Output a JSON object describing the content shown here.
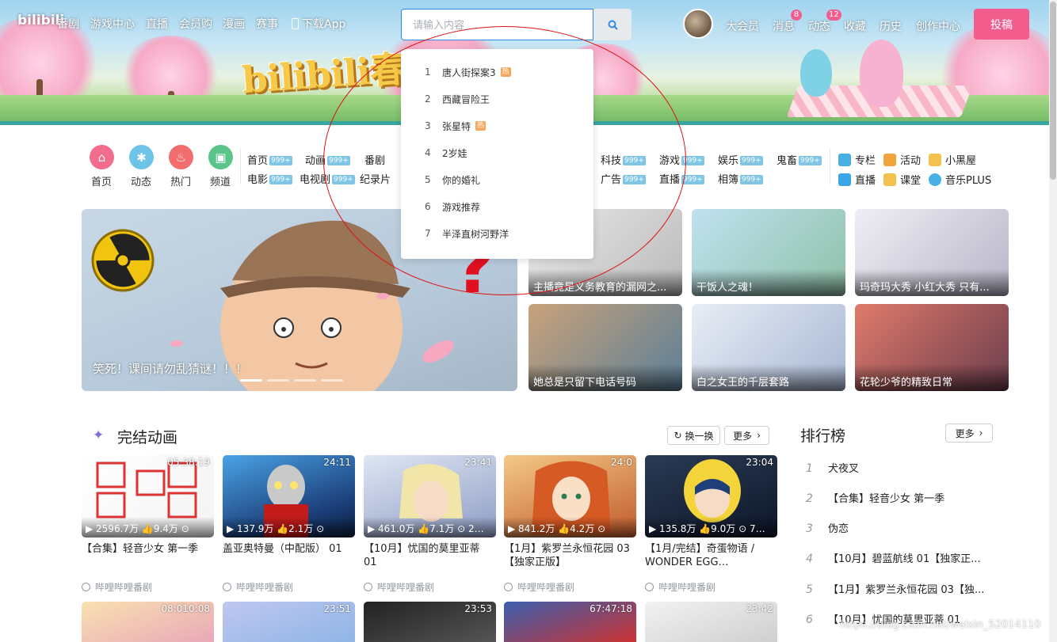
{
  "header": {
    "brand": "bilibili",
    "nav": [
      "番剧",
      "游戏中心",
      "直播",
      "会员购",
      "漫画",
      "赛事"
    ],
    "download": "下载App",
    "banner_logo": "bilibili春",
    "search": {
      "placeholder": "请输入内容",
      "icon": "search-icon"
    },
    "right": [
      "大会员",
      "消息",
      "动态",
      "收藏",
      "历史",
      "创作中心"
    ],
    "badges": {
      "messages": "8",
      "dynamics": "12"
    },
    "upload": "投稿"
  },
  "suggestions": [
    {
      "n": "1",
      "text": "唐人街探案3",
      "hot": "热"
    },
    {
      "n": "2",
      "text": "西藏冒险王",
      "hot": ""
    },
    {
      "n": "3",
      "text": "张星特",
      "hot": "热"
    },
    {
      "n": "4",
      "text": "2岁娃",
      "hot": ""
    },
    {
      "n": "5",
      "text": "你的婚礼",
      "hot": ""
    },
    {
      "n": "6",
      "text": "游戏推荐",
      "hot": ""
    },
    {
      "n": "7",
      "text": "半泽直树河野洋",
      "hot": ""
    }
  ],
  "channels": [
    {
      "label": "首页",
      "color": "#f16c8d",
      "icon": "home-icon"
    },
    {
      "label": "动态",
      "color": "#6ec4e8",
      "icon": "pinwheel-icon"
    },
    {
      "label": "热门",
      "color": "#f26d6d",
      "icon": "fire-icon"
    },
    {
      "label": "频道",
      "color": "#5bc48a",
      "icon": "channel-icon"
    }
  ],
  "categories_row1": [
    {
      "name": "首页",
      "count": "999+"
    },
    {
      "name": "动画",
      "count": "999+"
    },
    {
      "name": "番剧",
      "count": "999+"
    },
    {
      "name": "科技",
      "count": "999+"
    },
    {
      "name": "游戏",
      "count": "999+"
    },
    {
      "name": "娱乐",
      "count": "999+"
    },
    {
      "name": "鬼畜",
      "count": "999+"
    }
  ],
  "categories_row2": [
    {
      "name": "电影",
      "count": "999+"
    },
    {
      "name": "电视剧",
      "count": "999+"
    },
    {
      "name": "纪录片",
      "count": "999+"
    },
    {
      "name": "广告",
      "count": "999+"
    },
    {
      "name": "直播",
      "count": "999+"
    },
    {
      "name": "相簿",
      "count": "999+"
    }
  ],
  "extras": [
    {
      "label": "专栏",
      "color": "#48b0e3"
    },
    {
      "label": "活动",
      "color": "#f2a33a"
    },
    {
      "label": "小黑屋",
      "color": "#f2c14e"
    },
    {
      "label": "直播",
      "color": "#3aa6e8"
    },
    {
      "label": "课堂",
      "color": "#f2c14e"
    },
    {
      "label": "音乐PLUS",
      "color": "#48b0e3"
    }
  ],
  "hero": {
    "title": "笑死！课间请勿乱猜谜！！！"
  },
  "promo": [
    {
      "caption": "主播竟是义务教育的漏网之..."
    },
    {
      "caption": "干饭人之魂！"
    },
    {
      "caption": "玛奇玛大秀 小红大秀 只有..."
    },
    {
      "caption": "她总是只留下电话号码"
    },
    {
      "caption": "白之女王的千层套路"
    },
    {
      "caption": "花轮少爷的精致日常"
    }
  ],
  "section": {
    "title": "完结动画",
    "refresh": "换一换",
    "more": "更多"
  },
  "videos": [
    {
      "duration": "05:38:19",
      "plays": "2596.7万",
      "likes": "9.4万",
      "title": "【合集】轻音少女 第一季",
      "uploader": "哔哩哔哩番剧"
    },
    {
      "duration": "24:11",
      "plays": "137.9万",
      "likes": "2.1万",
      "title": "盖亚奥特曼（中配版） 01",
      "uploader": "哔哩哔哩番剧"
    },
    {
      "duration": "23:41",
      "plays": "461.0万",
      "likes": "7.1万",
      "title": "【10月】忧国的莫里亚蒂 01",
      "uploader": "哔哩哔哩番剧"
    },
    {
      "duration": "24:0",
      "plays": "841.2万",
      "likes": "4.2万",
      "title": "【1月】紫罗兰永恒花园 03【独家正版】",
      "uploader": "哔哩哔哩番剧"
    },
    {
      "duration": "23:04",
      "plays": "135.8万",
      "likes": "9.0万",
      "title": "【1月/完结】奇蛋物语 / WONDER EGG…",
      "uploader": "哔哩哔哩番剧"
    }
  ],
  "videos_row2": [
    "08:010:08",
    "23:51",
    "23:53",
    "67:47:18",
    "23:42"
  ],
  "ranking": {
    "title": "排行榜",
    "more": "更多",
    "items": [
      {
        "n": "1",
        "text": "犬夜叉"
      },
      {
        "n": "2",
        "text": "【合集】轻音少女 第一季"
      },
      {
        "n": "3",
        "text": "伪恋"
      },
      {
        "n": "4",
        "text": "【10月】碧蓝航线 01【独家正..."
      },
      {
        "n": "5",
        "text": "【1月】紫罗兰永恒花园 03【独..."
      },
      {
        "n": "6",
        "text": "【10月】忧国的莫里亚蒂 01"
      }
    ]
  },
  "watermark": "https://blog.csdn.net/weixin_52014110"
}
